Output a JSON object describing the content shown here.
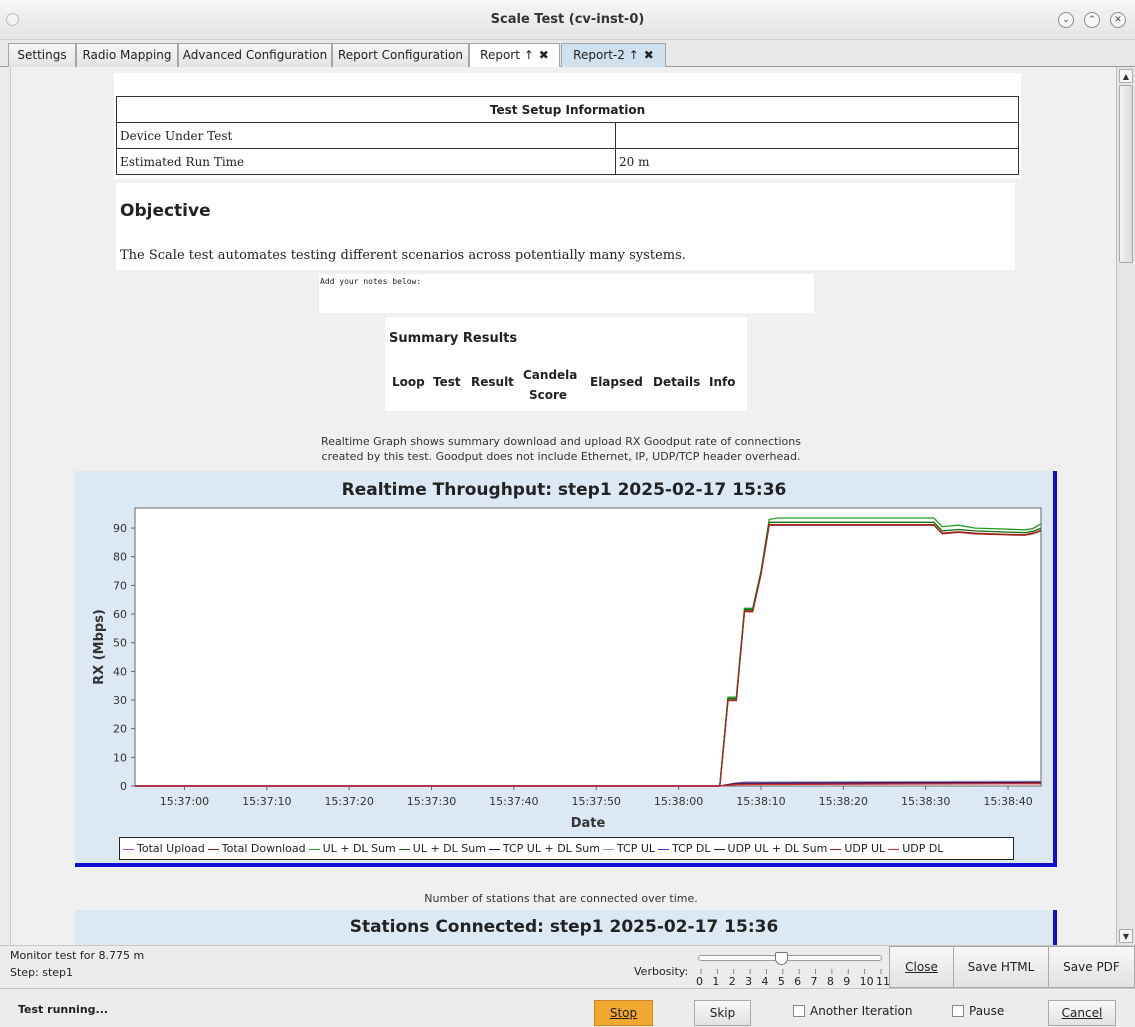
{
  "window": {
    "title": "Scale Test  (cv-inst-0)",
    "controls": [
      "minimize",
      "maximize",
      "close"
    ]
  },
  "tabs": [
    {
      "label": "Settings"
    },
    {
      "label": "Radio Mapping"
    },
    {
      "label": "Advanced Configuration"
    },
    {
      "label": "Report Configuration"
    },
    {
      "label": "Report ↑",
      "close": "✖"
    },
    {
      "label": "Report-2 ↑",
      "close": "✖"
    }
  ],
  "setup": {
    "title": "Test Setup Information",
    "rows": [
      [
        "Device Under Test",
        ""
      ],
      [
        "Estimated Run Time",
        "20 m"
      ]
    ]
  },
  "objective": {
    "heading": "Objective",
    "text": "The Scale test automates testing different scenarios across potentially many systems."
  },
  "notes": {
    "placeholder": "Add your notes below:"
  },
  "summary": {
    "title": "Summary Results",
    "columns": [
      "Loop",
      "Test",
      "Result",
      "Candela Score",
      "Elapsed",
      "Details",
      "Info"
    ]
  },
  "realtime_desc": {
    "line1": "Realtime Graph shows summary download and upload RX Goodput rate of connections",
    "line2": "created by this test. Goodput does not include Ethernet, IP, UDP/TCP header overhead."
  },
  "stations_desc": "Number of stations that are connected over time.",
  "chart_data": {
    "type": "line",
    "title": "Realtime Throughput: step1 2025-02-17 15:36",
    "xlabel": "Date",
    "ylabel": "RX (Mbps)",
    "ylim": [
      0,
      97
    ],
    "xlim": [
      "15:36:54",
      "15:38:44"
    ],
    "x_ticks": [
      "15:37:00",
      "15:37:10",
      "15:37:20",
      "15:37:30",
      "15:37:40",
      "15:37:50",
      "15:38:00",
      "15:38:10",
      "15:38:20",
      "15:38:30",
      "15:38:40"
    ],
    "y_ticks": [
      0,
      10,
      20,
      30,
      40,
      50,
      60,
      70,
      80,
      90
    ],
    "legend": "bottom",
    "grid": false,
    "series": [
      {
        "name": "Total Upload",
        "color": "#c040c0",
        "x": [
          "15:36:54",
          "15:38:05",
          "15:38:07",
          "15:38:44"
        ],
        "values": [
          0,
          0,
          0.8,
          1.2
        ]
      },
      {
        "name": "Total Download",
        "color": "#8b2a1a",
        "x": [
          "15:36:54",
          "15:38:05",
          "15:38:06",
          "15:38:07",
          "15:38:08",
          "15:38:09",
          "15:38:10",
          "15:38:11",
          "15:38:12",
          "15:38:31",
          "15:38:32",
          "15:38:34",
          "15:38:36",
          "15:38:38",
          "15:38:40",
          "15:38:42",
          "15:38:43",
          "15:38:44"
        ],
        "values": [
          0,
          0,
          30,
          30,
          61,
          61,
          74,
          91,
          91,
          91,
          88,
          88.5,
          88,
          87.8,
          87.6,
          87.5,
          88,
          89
        ]
      },
      {
        "name": "UL + DL Sum",
        "color": "#1e9e1e",
        "x": [
          "15:36:54",
          "15:38:05",
          "15:38:06",
          "15:38:07",
          "15:38:08",
          "15:38:09",
          "15:38:10",
          "15:38:11",
          "15:38:12",
          "15:38:31",
          "15:38:32",
          "15:38:34",
          "15:38:36",
          "15:38:38",
          "15:38:40",
          "15:38:42",
          "15:38:43",
          "15:38:44"
        ],
        "values": [
          0,
          0,
          31,
          31,
          62,
          62,
          75,
          93,
          93.5,
          93.5,
          90.5,
          91,
          90,
          89.8,
          89.6,
          89.4,
          89.8,
          91.5
        ]
      },
      {
        "name": "UL + DL Sum",
        "color": "#0c6e0c",
        "x": [
          "15:36:54",
          "15:38:05",
          "15:38:06",
          "15:38:07",
          "15:38:08",
          "15:38:09",
          "15:38:10",
          "15:38:11",
          "15:38:12",
          "15:38:31",
          "15:38:32",
          "15:38:34",
          "15:38:36",
          "15:38:38",
          "15:38:40",
          "15:38:42",
          "15:38:43",
          "15:38:44"
        ],
        "values": [
          0,
          0,
          30.5,
          30.5,
          61.5,
          61.5,
          74.5,
          92,
          92,
          92,
          89,
          89.5,
          89,
          88.8,
          88.6,
          88.4,
          88.8,
          90
        ]
      },
      {
        "name": "TCP UL + DL Sum",
        "color": "#101060",
        "x": [
          "15:36:54",
          "15:38:05",
          "15:38:07",
          "15:38:44"
        ],
        "values": [
          0,
          0,
          0.6,
          1
        ]
      },
      {
        "name": "TCP UL",
        "color": "#8899dd",
        "x": [
          "15:36:54",
          "15:38:05",
          "15:38:08",
          "15:38:44"
        ],
        "values": [
          0,
          0,
          1.4,
          1.6
        ]
      },
      {
        "name": "TCP DL",
        "color": "#3838c8",
        "x": [
          "15:36:54",
          "15:38:05",
          "15:38:07",
          "15:38:44"
        ],
        "values": [
          0,
          0,
          0.9,
          1.1
        ]
      },
      {
        "name": "UDP UL + DL Sum",
        "color": "#551144",
        "x": [
          "15:36:54",
          "15:38:05",
          "15:38:07",
          "15:38:44"
        ],
        "values": [
          0,
          0,
          1.0,
          1.3
        ]
      },
      {
        "name": "UDP UL",
        "color": "#aa2222",
        "x": [
          "15:36:54",
          "15:38:05",
          "15:38:06",
          "15:38:07",
          "15:38:08",
          "15:38:09",
          "15:38:10",
          "15:38:11",
          "15:38:12",
          "15:38:31",
          "15:38:32",
          "15:38:34",
          "15:38:36",
          "15:38:38",
          "15:38:40",
          "15:38:42",
          "15:38:43",
          "15:38:44"
        ],
        "values": [
          0,
          0,
          29.8,
          29.8,
          60.8,
          60.8,
          73.8,
          91.2,
          91.2,
          91.2,
          88.2,
          88.7,
          88.2,
          88,
          87.8,
          87.7,
          88.2,
          89.2
        ]
      },
      {
        "name": "UDP DL",
        "color": "#cc3030",
        "x": [
          "15:36:54",
          "15:38:05",
          "15:38:07",
          "15:38:44"
        ],
        "values": [
          0,
          0,
          0.5,
          0.8
        ]
      }
    ]
  },
  "stations": {
    "title": "Stations Connected: step1 2025-02-17 15:36"
  },
  "bottom": {
    "monitor": "Monitor test for 8.775 m",
    "step": "Step: step1",
    "verbosity_label": "Verbosity:",
    "verbosity_value": 5,
    "verbosity_ticks": [
      "0",
      "1",
      "2",
      "3",
      "4",
      "5",
      "6",
      "7",
      "8",
      "9",
      "10",
      "11"
    ],
    "buttons": {
      "close": "Close",
      "save_html": "Save HTML",
      "save_pdf": "Save PDF"
    }
  },
  "status": {
    "text": "Test running...",
    "stop": "Stop",
    "skip": "Skip",
    "another_iteration": "Another Iteration",
    "pause": "Pause",
    "cancel": "Cancel"
  },
  "colors": {
    "stop_button": "#f0a830",
    "chart_panel": "#dce8f4",
    "panel_border": "#1010d0"
  }
}
